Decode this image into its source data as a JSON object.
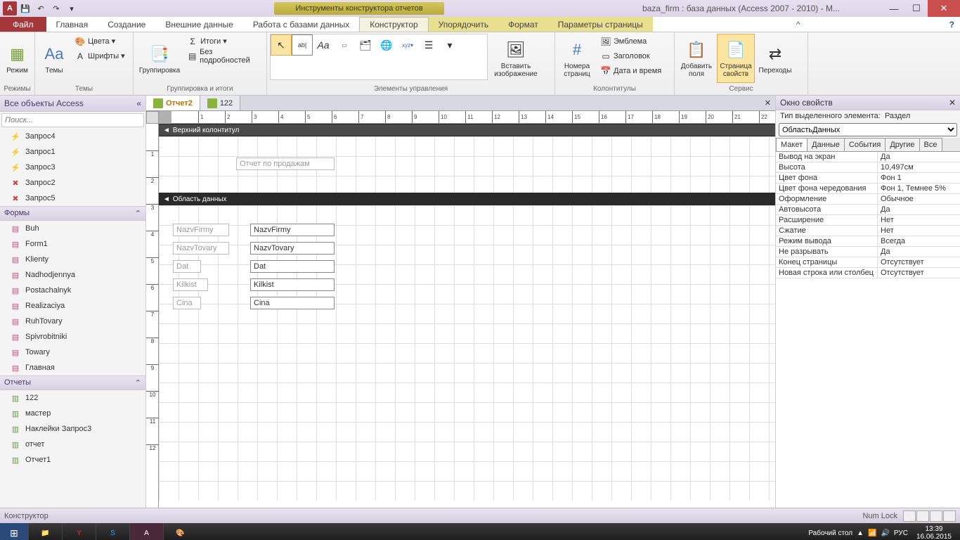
{
  "title": "baza_firm : база данных (Access 2007 - 2010) - M...",
  "contextual_title": "Инструменты конструктора отчетов",
  "ribbon_tabs": {
    "file": "Файл",
    "home": "Главная",
    "create": "Создание",
    "external": "Внешние данные",
    "dbtools": "Работа с базами данных",
    "design": "Конструктор",
    "arrange": "Упорядочить",
    "format": "Формат",
    "page": "Параметры страницы"
  },
  "ribbon": {
    "modes": {
      "label": "Режимы",
      "view": "Режим"
    },
    "themes": {
      "label": "Темы",
      "themes": "Темы",
      "colors": "Цвета",
      "fonts": "Шрифты"
    },
    "grouping": {
      "label": "Группировка и итоги",
      "group": "Группировка",
      "totals": "Итоги",
      "details": "Без подробностей"
    },
    "controls": {
      "label": "Элементы управления",
      "insert_image": "Вставить изображение"
    },
    "headers": {
      "label": "Колонтитулы",
      "page_nums": "Номера страниц",
      "emblem": "Эмблема",
      "title": "Заголовок",
      "datetime": "Дата и время"
    },
    "tools": {
      "label": "Сервис",
      "add_fields": "Добавить поля",
      "prop_sheet": "Страница свойств",
      "tab_order": "Переходы"
    }
  },
  "nav": {
    "header": "Все объекты Access",
    "search_placeholder": "Поиск...",
    "queries": [
      "Запрос4",
      "Запрос1",
      "Запрос3",
      "Запрос2",
      "Запрос5"
    ],
    "forms_hdr": "Формы",
    "forms": [
      "Buh",
      "Form1",
      "Klienty",
      "Nadhodjennya",
      "Postachalnyk",
      "Realizaciya",
      "RuhTovary",
      "Spivrobitniki",
      "Towary",
      "Главная"
    ],
    "reports_hdr": "Отчеты",
    "reports": [
      "122",
      "мастер",
      "Наклейки Запрос3",
      "отчет",
      "Отчет1"
    ]
  },
  "doc_tabs": {
    "active": "Отчет2",
    "other": "122"
  },
  "sections": {
    "page_header": "Верхний колонтитул",
    "detail": "Область данных"
  },
  "report_title": "Отчет по продажам",
  "fields": {
    "labels": [
      "NazvFirmy",
      "NazvTovary",
      "Dat",
      "Kilkist",
      "Cina"
    ],
    "bound": [
      "NazvFirmy",
      "NazvTovary",
      "Dat",
      "Kilkist",
      "Cina"
    ]
  },
  "props": {
    "pane_title": "Окно свойств",
    "type_label": "Тип выделенного элемента:",
    "type_value": "Раздел",
    "selector": "ОбластьДанных",
    "tabs": {
      "format": "Макет",
      "data": "Данные",
      "event": "События",
      "other": "Другие",
      "all": "Все"
    },
    "rows": [
      {
        "n": "Вывод на экран",
        "v": "Да"
      },
      {
        "n": "Высота",
        "v": "10,497см"
      },
      {
        "n": "Цвет фона",
        "v": "Фон 1"
      },
      {
        "n": "Цвет фона чередования",
        "v": "Фон 1, Темнее 5%"
      },
      {
        "n": "Оформление",
        "v": "Обычное"
      },
      {
        "n": "Автовысота",
        "v": "Да"
      },
      {
        "n": "Расширение",
        "v": "Нет"
      },
      {
        "n": "Сжатие",
        "v": "Нет"
      },
      {
        "n": "Режим вывода",
        "v": "Всегда"
      },
      {
        "n": "Не разрывать",
        "v": "Да"
      },
      {
        "n": "Конец страницы",
        "v": "Отсутствует"
      },
      {
        "n": "Новая строка или столбец",
        "v": "Отсутствует"
      }
    ]
  },
  "status": {
    "mode": "Конструктор",
    "numlock": "Num Lock"
  },
  "taskbar": {
    "desktop": "Рабочий стол",
    "lang": "РУС",
    "time": "13:39",
    "date": "16.06.2015"
  }
}
